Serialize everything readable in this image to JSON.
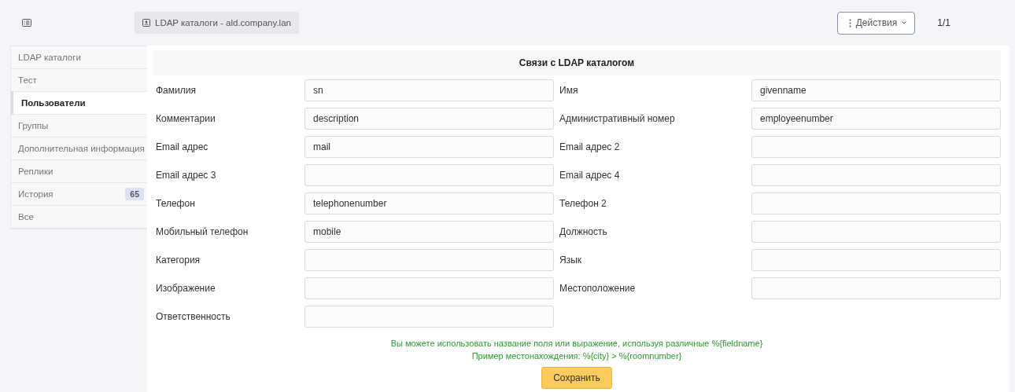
{
  "breadcrumb": "LDAP каталоги - ald.company.lan",
  "actions_button": "Действия",
  "pager": "1/1",
  "sidebar": {
    "items": [
      {
        "label": "LDAP каталоги",
        "selected": false
      },
      {
        "label": "Тест",
        "selected": false
      },
      {
        "label": "Пользователи",
        "selected": true
      },
      {
        "label": "Группы",
        "selected": false
      },
      {
        "label": "Дополнительная информация",
        "selected": false
      },
      {
        "label": "Реплики",
        "selected": false
      },
      {
        "label": "История",
        "selected": false,
        "badge": "65"
      },
      {
        "label": "Все",
        "selected": false
      }
    ]
  },
  "form": {
    "title": "Связи с LDAP каталогом",
    "fields": [
      {
        "label": "Фамилия",
        "value": "sn"
      },
      {
        "label": "Имя",
        "value": "givenname"
      },
      {
        "label": "Комментарии",
        "value": "description"
      },
      {
        "label": "Административный номер",
        "value": "employeenumber"
      },
      {
        "label": "Email адрес",
        "value": "mail"
      },
      {
        "label": "Email адрес 2"
      },
      {
        "label": "Email адрес 3"
      },
      {
        "label": "Email адрес 4"
      },
      {
        "label": "Телефон",
        "value": "telephonenumber"
      },
      {
        "label": "Телефон 2"
      },
      {
        "label": "Мобильный телефон",
        "value": "mobile"
      },
      {
        "label": "Должность"
      },
      {
        "label": "Категория"
      },
      {
        "label": "Язык"
      },
      {
        "label": "Изображение"
      },
      {
        "label": "Местоположение"
      },
      {
        "label": "Ответственность"
      }
    ],
    "hints": [
      "Вы можете использовать название поля или выражение, используя различные %{fieldname}",
      "Пример местонахождения: %{city} > %{roomnumber}"
    ],
    "save_button": "Сохранить"
  }
}
